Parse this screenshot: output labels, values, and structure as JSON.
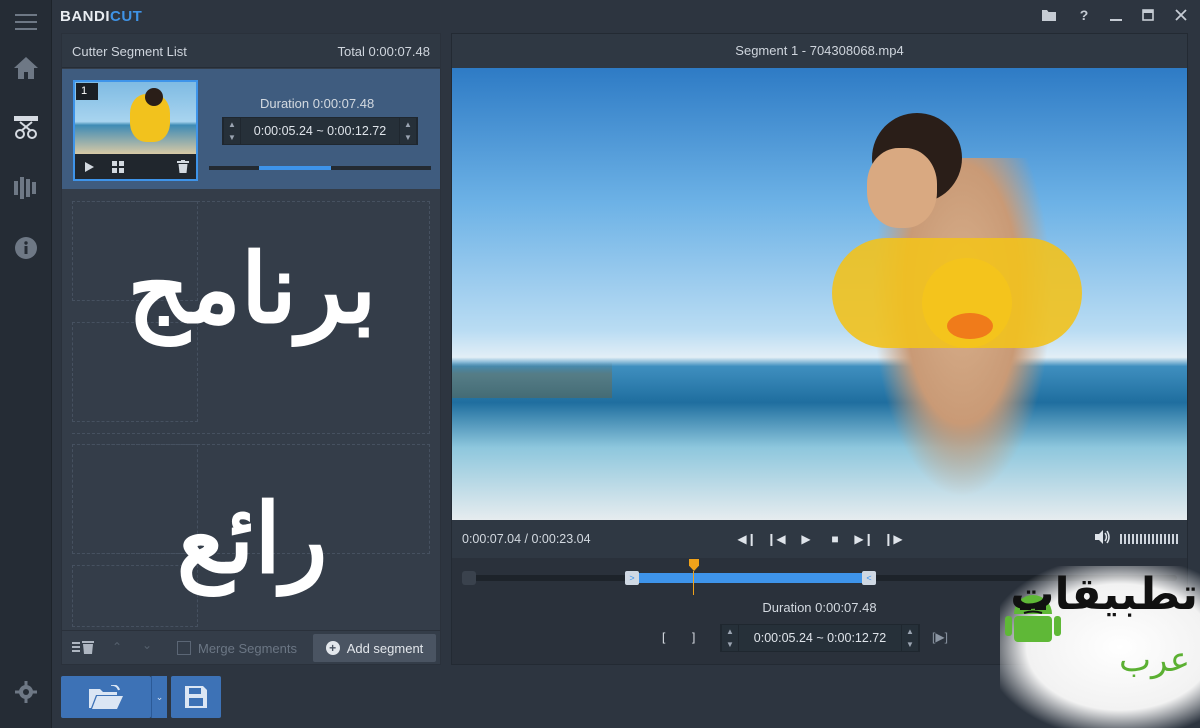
{
  "app": {
    "logo_main": "BANDI",
    "logo_accent": "CUT"
  },
  "rail": {
    "items": [
      "menu-icon",
      "home-icon",
      "cutter-icon",
      "encode-icon",
      "info-icon",
      "settings-icon"
    ]
  },
  "window_buttons": [
    "folder-icon",
    "help-icon",
    "minimize-icon",
    "maximize-icon",
    "close-icon"
  ],
  "left_panel": {
    "title": "Cutter Segment List",
    "total": "Total 0:00:07.48",
    "segment": {
      "number": "1",
      "duration": "Duration 0:00:07.48",
      "time_range": "0:00:05.24  ~  0:00:12.72",
      "progress": 0.33
    },
    "overlay_text_1": "برنامج",
    "overlay_text_2": "رائع",
    "footer": {
      "merge_label": "Merge Segments",
      "add_label": "Add segment"
    }
  },
  "right_panel": {
    "title": "Segment 1 - 704308068.mp4",
    "current_time": "0:00:07.04  /  0:00:23.04",
    "duration": "Duration 0:00:07.48",
    "time_range": "0:00:05.24  ~  0:00:12.72"
  },
  "watermark": {
    "line1": "تطبيقات",
    "line2": "عرب"
  },
  "colors": {
    "accent": "#3e94ea",
    "marker": "#f0a21a",
    "button": "#3d72b6"
  }
}
